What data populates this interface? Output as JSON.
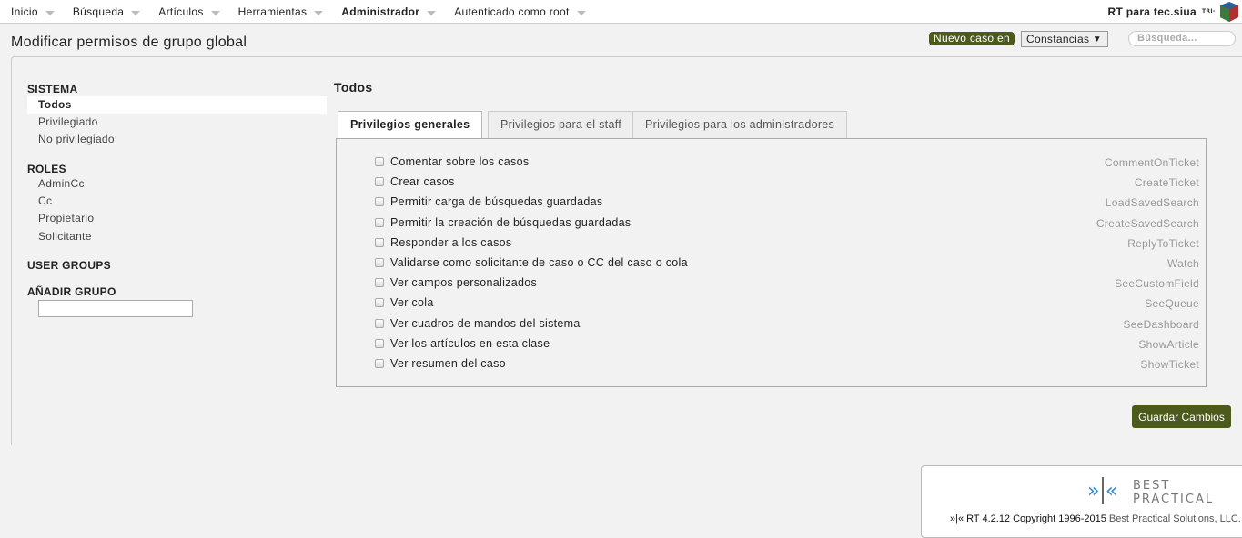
{
  "topbar": {
    "menu": [
      {
        "label": "Inicio"
      },
      {
        "label": "Búsqueda"
      },
      {
        "label": "Artículos"
      },
      {
        "label": "Herramientas"
      },
      {
        "label": "Administrador"
      },
      {
        "label": "Autenticado como root"
      }
    ],
    "site_name": "RT para tec.siua",
    "logo_text": "TRI-"
  },
  "header": {
    "title": "Modificar permisos de grupo global",
    "new_case_label": "Nuevo caso en",
    "queue_selected": "Constancias",
    "search_placeholder": "Búsqueda..."
  },
  "sidebar": {
    "sistema_title": "SISTEMA",
    "sistema_items": [
      "Todos",
      "Privilegiado",
      "No privilegiado"
    ],
    "roles_title": "ROLES",
    "roles_items": [
      "AdminCc",
      "Cc",
      "Propietario",
      "Solicitante"
    ],
    "user_groups_title": "USER GROUPS",
    "add_group_title": "AÑADIR GRUPO",
    "add_group_value": ""
  },
  "main": {
    "heading": "Todos",
    "tabs": [
      {
        "label": "Privilegios generales",
        "active": true
      },
      {
        "label": "Privilegios para el staff"
      },
      {
        "label": "Privilegios para los administradores"
      }
    ],
    "rights": [
      {
        "label": "Comentar sobre los casos",
        "right": "CommentOnTicket",
        "checked": false
      },
      {
        "label": "Crear casos",
        "right": "CreateTicket",
        "checked": false
      },
      {
        "label": "Permitir carga de búsquedas guardadas",
        "right": "LoadSavedSearch",
        "checked": false
      },
      {
        "label": "Permitir la creación de búsquedas guardadas",
        "right": "CreateSavedSearch",
        "checked": false
      },
      {
        "label": "Responder a los casos",
        "right": "ReplyToTicket",
        "checked": false
      },
      {
        "label": "Validarse como solicitante de caso o CC del caso o cola",
        "right": "Watch",
        "checked": false
      },
      {
        "label": "Ver campos personalizados",
        "right": "SeeCustomField",
        "checked": false
      },
      {
        "label": "Ver cola",
        "right": "SeeQueue",
        "checked": false
      },
      {
        "label": "Ver cuadros de mandos del sistema",
        "right": "SeeDashboard",
        "checked": false
      },
      {
        "label": "Ver los artículos en esta clase",
        "right": "ShowArticle",
        "checked": false
      },
      {
        "label": "Ver resumen del caso",
        "right": "ShowTicket",
        "checked": false
      }
    ],
    "save_label": "Guardar Cambios"
  },
  "footer": {
    "logo_line1": "BEST",
    "logo_line2": "PRACTICAL",
    "version": "»|« RT 4.2.12 Copyright 1996-2015",
    "company": "Best Practical Solutions, LLC."
  },
  "colors": {
    "accent": "#4c5a1b",
    "logo_blue": "#2a8ad4"
  }
}
